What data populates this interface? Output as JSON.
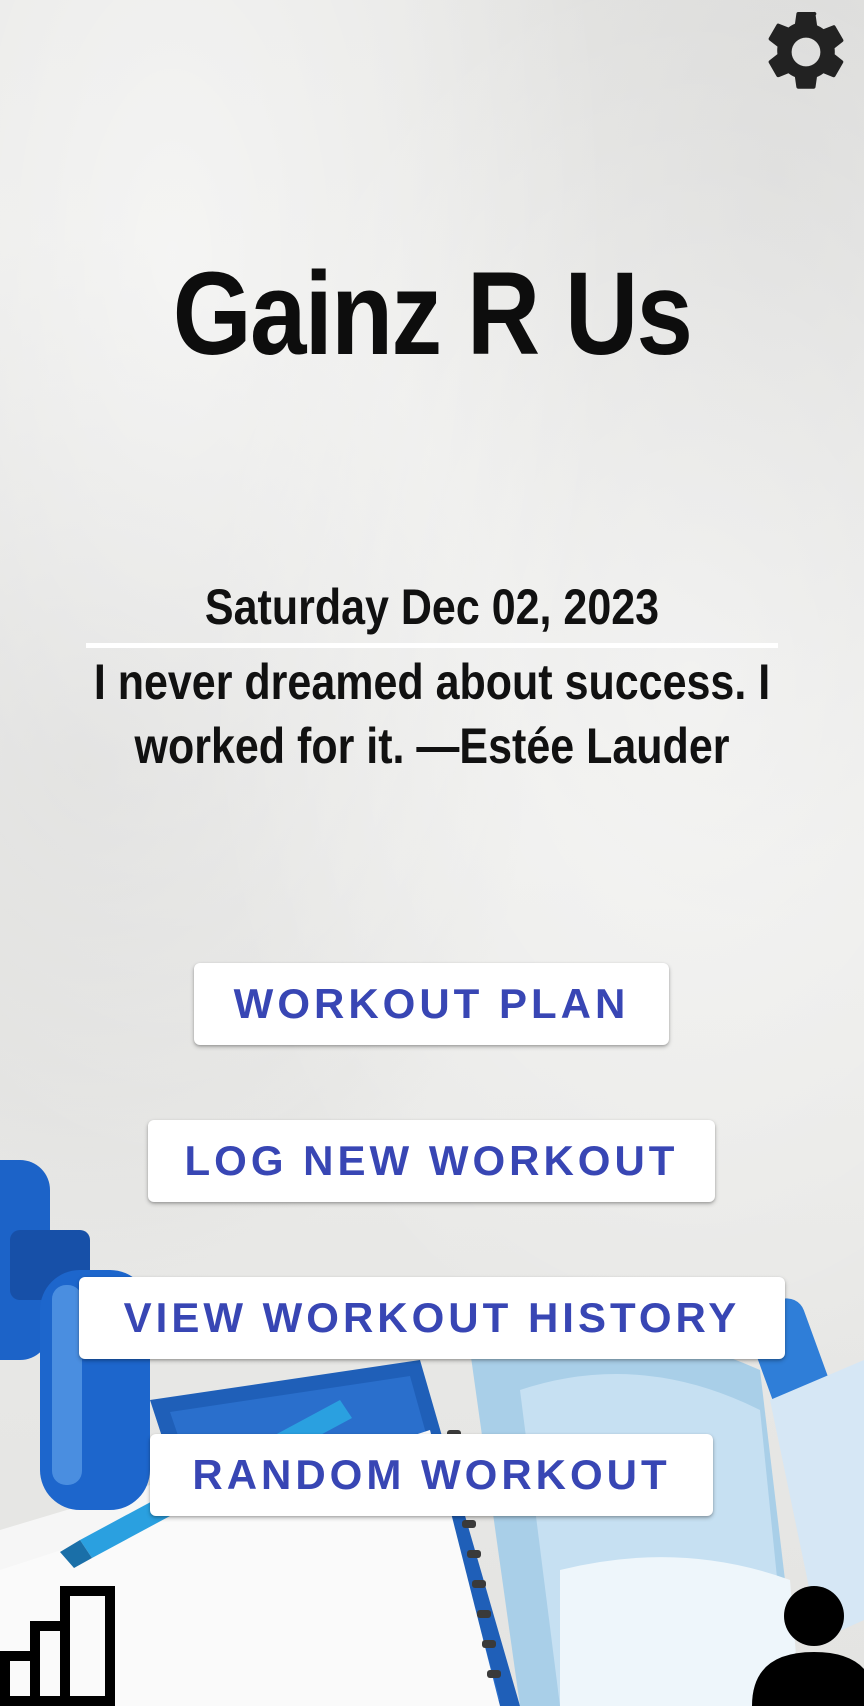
{
  "app": {
    "title": "Gainz R Us"
  },
  "header": {
    "date": "Saturday Dec 02, 2023",
    "quote": "I never dreamed about success. I worked for it. —Estée Lauder"
  },
  "menu": {
    "workout_plan": "WORKOUT PLAN",
    "log_new_workout": "LOG NEW WORKOUT",
    "view_workout_history": "VIEW WORKOUT HISTORY",
    "random_workout": "RANDOM WORKOUT"
  },
  "icons": {
    "settings": "gear-icon",
    "stats": "bar-chart-icon",
    "profile": "person-icon"
  },
  "colors": {
    "button_text": "#3846b4",
    "button_bg": "#ffffff",
    "text": "#111111"
  }
}
